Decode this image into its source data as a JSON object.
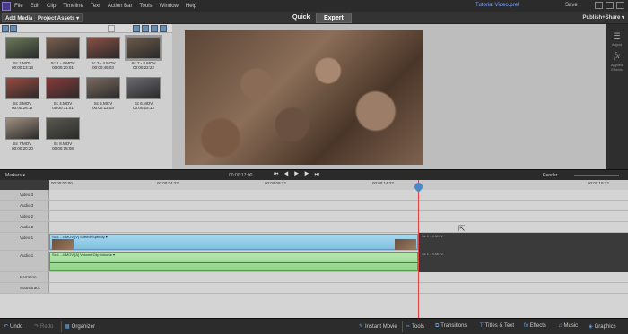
{
  "menu": [
    "File",
    "Edit",
    "Clip",
    "Timeline",
    "Text",
    "Action Bar",
    "Tools",
    "Window",
    "Help"
  ],
  "app_title": "Tutorial Video.prel",
  "save_label": "Save",
  "toolbar": {
    "add_media": "Add Media ▾",
    "project_assets": "Project Assets ▾",
    "quick": "Quick",
    "expert": "Expert",
    "publish": "Publish+Share ▾"
  },
  "assets": [
    {
      "name": "Sc 1.MOV",
      "dur": "00:00:13:13",
      "color": "#6a7a5a"
    },
    {
      "name": "Sc 1 - 4.MOV",
      "dur": "00:00:20:01",
      "color": "#7a6050"
    },
    {
      "name": "Sc 2 - 4.MOV",
      "dur": "00:00:45:03",
      "color": "#8a5045"
    },
    {
      "name": "Sc 2 - 8.MOV",
      "dur": "00:00:22:22",
      "color": "#6a5a4a"
    },
    {
      "name": "Sc 3.MOV",
      "dur": "00:00:26:17",
      "color": "#9a4a40"
    },
    {
      "name": "Sc 4.MOV",
      "dur": "00:00:11:01",
      "color": "#8a3a3a"
    },
    {
      "name": "Sc 5.MOV",
      "dur": "00:00:12:03",
      "color": "#7a6a60"
    },
    {
      "name": "Sc 6.MOV",
      "dur": "00:00:15:13",
      "color": "#6a6a70"
    },
    {
      "name": "Sc 7.MOV",
      "dur": "00:00:20:20",
      "color": "#a09080"
    },
    {
      "name": "Sc 8.MOV",
      "dur": "00:00:18:08",
      "color": "#5a5a50"
    }
  ],
  "right_panel": {
    "adjust": "Adjust",
    "applied": "Applied Effects"
  },
  "timeline": {
    "label": "Markers ▾",
    "timecode": "00:00:17:00",
    "render": "Render",
    "ruler": [
      "00:00:00:00",
      "00:00:04:23",
      "00:00:09:23",
      "00:00:14:23",
      "00:00:19:23"
    ],
    "tracks": [
      "Video 3",
      "Audio 3",
      "Video 2",
      "Audio 2",
      "Video 1",
      "Audio 1",
      "Narration",
      "Soundtrack"
    ],
    "video_clip": "Sc 1 - 4.MOV [V] Speed+Speedy ▾",
    "audio_clip": "Sc 1 - 4.MOV [A] Volume:Clip Volume ▾",
    "trail_label": "Sc 1 - 4.MOV"
  },
  "bottom": {
    "undo": "Undo",
    "redo": "Redo",
    "organizer": "Organizer",
    "instant": "Instant Movie",
    "tools": "Tools",
    "transitions": "Transitions",
    "titles": "Titles & Text",
    "effects": "Effects",
    "music": "Music",
    "graphics": "Graphics"
  }
}
